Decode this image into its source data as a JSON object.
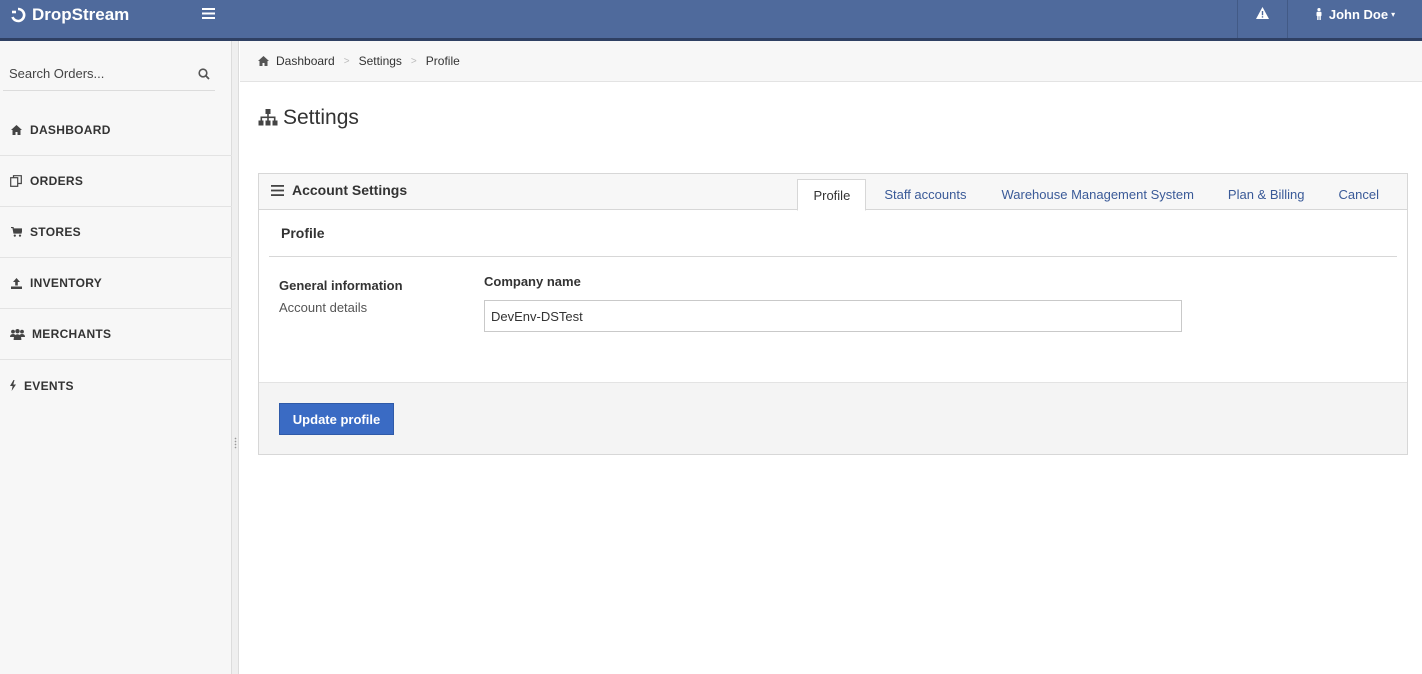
{
  "app": {
    "brand": "DropStream",
    "user_name": "John Doe"
  },
  "sidebar": {
    "search_placeholder": "Search Orders...",
    "items": [
      {
        "label": "DASHBOARD",
        "icon": "home-icon"
      },
      {
        "label": "ORDERS",
        "icon": "copy-icon"
      },
      {
        "label": "STORES",
        "icon": "cart-icon"
      },
      {
        "label": "INVENTORY",
        "icon": "upload-icon"
      },
      {
        "label": "MERCHANTS",
        "icon": "users-icon"
      },
      {
        "label": "EVENTS",
        "icon": "bolt-icon"
      }
    ]
  },
  "breadcrumb": {
    "items": [
      "Dashboard",
      "Settings",
      "Profile"
    ]
  },
  "page": {
    "title": "Settings"
  },
  "panel": {
    "title": "Account Settings",
    "tabs": [
      {
        "label": "Profile",
        "active": true
      },
      {
        "label": "Staff accounts",
        "active": false
      },
      {
        "label": "Warehouse Management System",
        "active": false
      },
      {
        "label": "Plan & Billing",
        "active": false
      },
      {
        "label": "Cancel",
        "active": false
      }
    ],
    "section_heading": "Profile",
    "info_title": "General information",
    "info_subtitle": "Account details",
    "company_label": "Company name",
    "company_value": "DevEnv-DSTest",
    "update_button": "Update profile"
  },
  "colors": {
    "navbar": "#4f6a9c",
    "primary_button": "#3a6bc4",
    "link": "#3a5a98"
  }
}
